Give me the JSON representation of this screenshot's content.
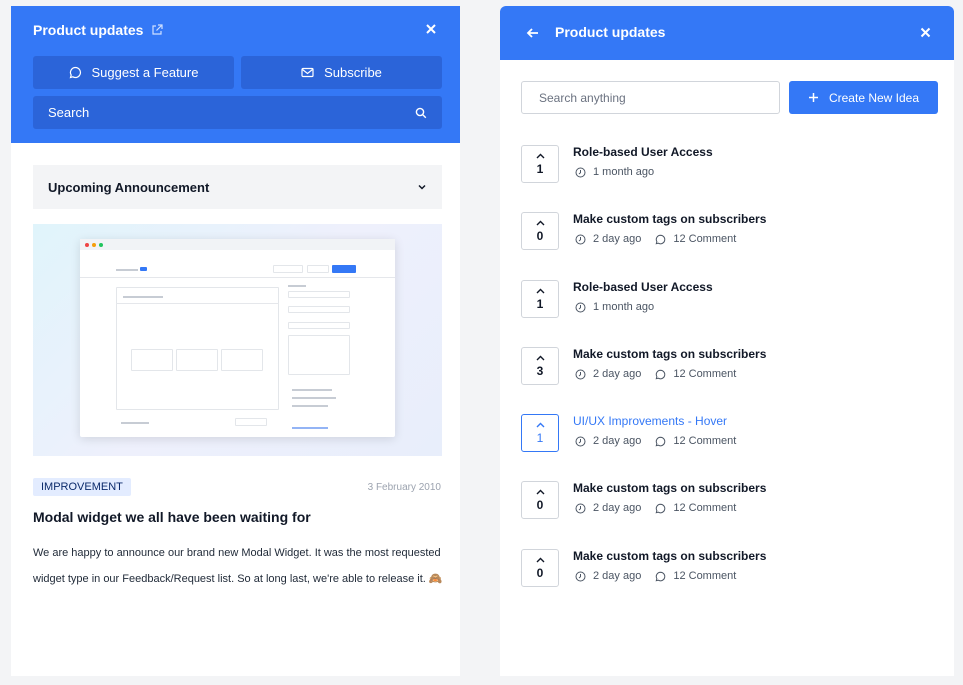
{
  "left_panel": {
    "title": "Product updates",
    "suggest_label": "Suggest a Feature",
    "subscribe_label": "Subscribe",
    "search_label": "Search",
    "section_title": "Upcoming Announcement",
    "post": {
      "tag": "IMPROVEMENT",
      "date": "3 February 2010",
      "title": "Modal widget we all have been waiting for",
      "body": "We are happy to announce our brand new Modal Widget. It was the most requested widget type in our Feedback/Request list. So at long last, we're able to release it. 🙈"
    }
  },
  "right_panel": {
    "title": "Product updates",
    "search_placeholder": "Search anything",
    "create_label": "Create New Idea",
    "ideas": [
      {
        "title": "Role-based User Access",
        "votes": "1",
        "time": "1 month ago",
        "comments": ""
      },
      {
        "title": "Make custom tags on subscribers",
        "votes": "0",
        "time": "2 day ago",
        "comments": "12 Comment"
      },
      {
        "title": "Role-based User Access",
        "votes": "1",
        "time": "1 month ago",
        "comments": ""
      },
      {
        "title": "Make custom tags on subscribers",
        "votes": "3",
        "time": "2 day ago",
        "comments": "12 Comment"
      },
      {
        "title": "UI/UX Improvements - Hover",
        "votes": "1",
        "time": "2 day ago",
        "comments": "12 Comment"
      },
      {
        "title": "Make custom tags on subscribers",
        "votes": "0",
        "time": "2 day ago",
        "comments": "12 Comment"
      },
      {
        "title": "Make custom tags on subscribers",
        "votes": "0",
        "time": "2 day ago",
        "comments": "12 Comment"
      }
    ]
  },
  "colors": {
    "accent": "#3478f6",
    "accent_dark": "#2b64d9",
    "tag_bg": "#e3ecff"
  },
  "icons": [
    "external-link-icon",
    "close-icon",
    "chat-icon",
    "mail-icon",
    "search-icon",
    "chevron-down-icon",
    "arrow-left-icon",
    "plus-icon",
    "chevron-up-icon",
    "clock-icon",
    "comment-icon"
  ]
}
